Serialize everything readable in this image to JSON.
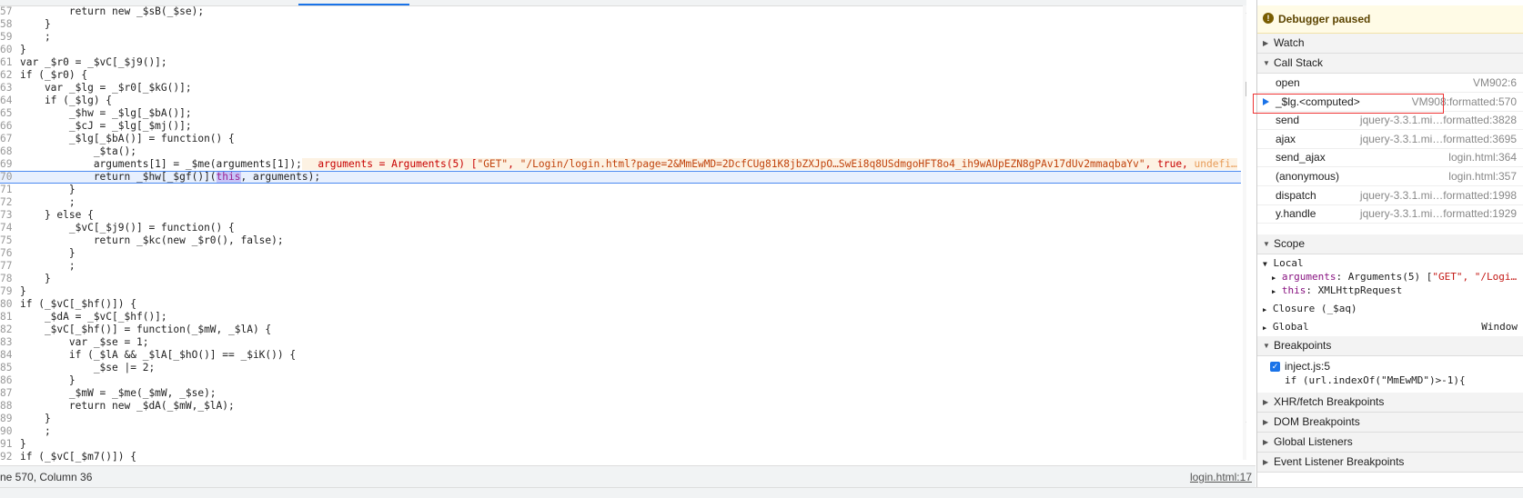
{
  "editor": {
    "lines": [
      {
        "n": "57",
        "code": "        return new _$sB(_$se);"
      },
      {
        "n": "58",
        "code": "    }"
      },
      {
        "n": "59",
        "code": "    ;"
      },
      {
        "n": "60",
        "code": "}"
      },
      {
        "n": "61",
        "code": "var _$r0 = _$vC[_$j9()];"
      },
      {
        "n": "62",
        "code": "if (_$r0) {"
      },
      {
        "n": "63",
        "code": "    var _$lg = _$r0[_$kG()];"
      },
      {
        "n": "64",
        "code": "    if (_$lg) {"
      },
      {
        "n": "65",
        "code": "        _$hw = _$lg[_$bA()];"
      },
      {
        "n": "66",
        "code": "        _$cJ = _$lg[_$mj()];"
      },
      {
        "n": "67",
        "code": "        _$lg[_$bA()] = function() {"
      },
      {
        "n": "68",
        "code": "            _$ta();"
      },
      {
        "n": "69",
        "code": "            arguments[1] = _$me(arguments[1]);"
      },
      {
        "n": "70",
        "code_pre": "            return _$hw[_$gf()](",
        "code_hl": "this",
        "code_post": ", arguments);"
      },
      {
        "n": "71",
        "code": "        }"
      },
      {
        "n": "72",
        "code": "        ;"
      },
      {
        "n": "73",
        "code": "    } else {"
      },
      {
        "n": "74",
        "code": "        _$vC[_$j9()] = function() {"
      },
      {
        "n": "75",
        "code": "            return _$kc(new _$r0(), false);"
      },
      {
        "n": "76",
        "code": "        }"
      },
      {
        "n": "77",
        "code": "        ;"
      },
      {
        "n": "78",
        "code": "    }"
      },
      {
        "n": "79",
        "code": "}"
      },
      {
        "n": "80",
        "code": "if (_$vC[_$hf()]) {"
      },
      {
        "n": "81",
        "code": "    _$dA = _$vC[_$hf()];"
      },
      {
        "n": "82",
        "code": "    _$vC[_$hf()] = function(_$mW, _$lA) {"
      },
      {
        "n": "83",
        "code": "        var _$se = 1;"
      },
      {
        "n": "84",
        "code": "        if (_$lA && _$lA[_$hO()] == _$iK()) {"
      },
      {
        "n": "85",
        "code": "            _$se |= 2;"
      },
      {
        "n": "86",
        "code": "        }"
      },
      {
        "n": "87",
        "code": "        _$mW = _$me(_$mW, _$se);"
      },
      {
        "n": "88",
        "code": "        return new _$dA(_$mW,_$lA);"
      },
      {
        "n": "89",
        "code": "    }"
      },
      {
        "n": "90",
        "code": "    ;"
      },
      {
        "n": "91",
        "code": "}"
      },
      {
        "n": "92",
        "code": "if (_$vC[_$m7()]) {"
      }
    ],
    "inline_value": {
      "prefix": "arguments = Arguments(5) [",
      "str1": "\"GET\"",
      "sep1": ", ",
      "str2": "\"/Login/login.html?page=2&MmEwMD=2DcfCUg81K8jbZXJpO…SwEi8q8USdmgoHFT8o4_ih9wAUpEZN8gPAv17dUv2mmaqbaYv\"",
      "sep2": ", true, ",
      "tail": "undefi…"
    }
  },
  "status": {
    "position": "ne 570, Column 36",
    "source_link": "login.html:17"
  },
  "debugger": {
    "paused_icon": "info-icon",
    "paused_label": "Debugger paused",
    "watch_label": "Watch",
    "call_stack_label": "Call Stack",
    "frames": [
      {
        "fn": "open",
        "loc": "VM902:6"
      },
      {
        "fn": "_$lg.<computed>",
        "loc": "VM908:formatted:570"
      },
      {
        "fn": "send",
        "loc": "jquery-3.3.1.mi…formatted:3828"
      },
      {
        "fn": "ajax",
        "loc": "jquery-3.3.1.mi…formatted:3695"
      },
      {
        "fn": "send_ajax",
        "loc": "login.html:364"
      },
      {
        "fn": "(anonymous)",
        "loc": "login.html:357"
      },
      {
        "fn": "dispatch",
        "loc": "jquery-3.3.1.mi…formatted:1998"
      },
      {
        "fn": "y.handle",
        "loc": "jquery-3.3.1.mi…formatted:1929"
      }
    ],
    "scope_label": "Scope",
    "local_label": "Local",
    "local_args_key": "arguments",
    "local_args_prefix": ": Arguments(5) [",
    "local_args_str": "\"GET\", \"/Logi…",
    "local_this_key": "this",
    "local_this_val": ": XMLHttpRequest",
    "closure_label": "Closure (_$aq)",
    "global_label": "Global",
    "global_value": "Window",
    "breakpoints_label": "Breakpoints",
    "breakpoint_file": "inject.js:5",
    "breakpoint_code": "if (url.indexOf(\"MmEwMD\")>-1){",
    "xhr_label": "XHR/fetch Breakpoints",
    "dom_label": "DOM Breakpoints",
    "global_listeners_label": "Global Listeners",
    "event_listener_label": "Event Listener Breakpoints"
  }
}
